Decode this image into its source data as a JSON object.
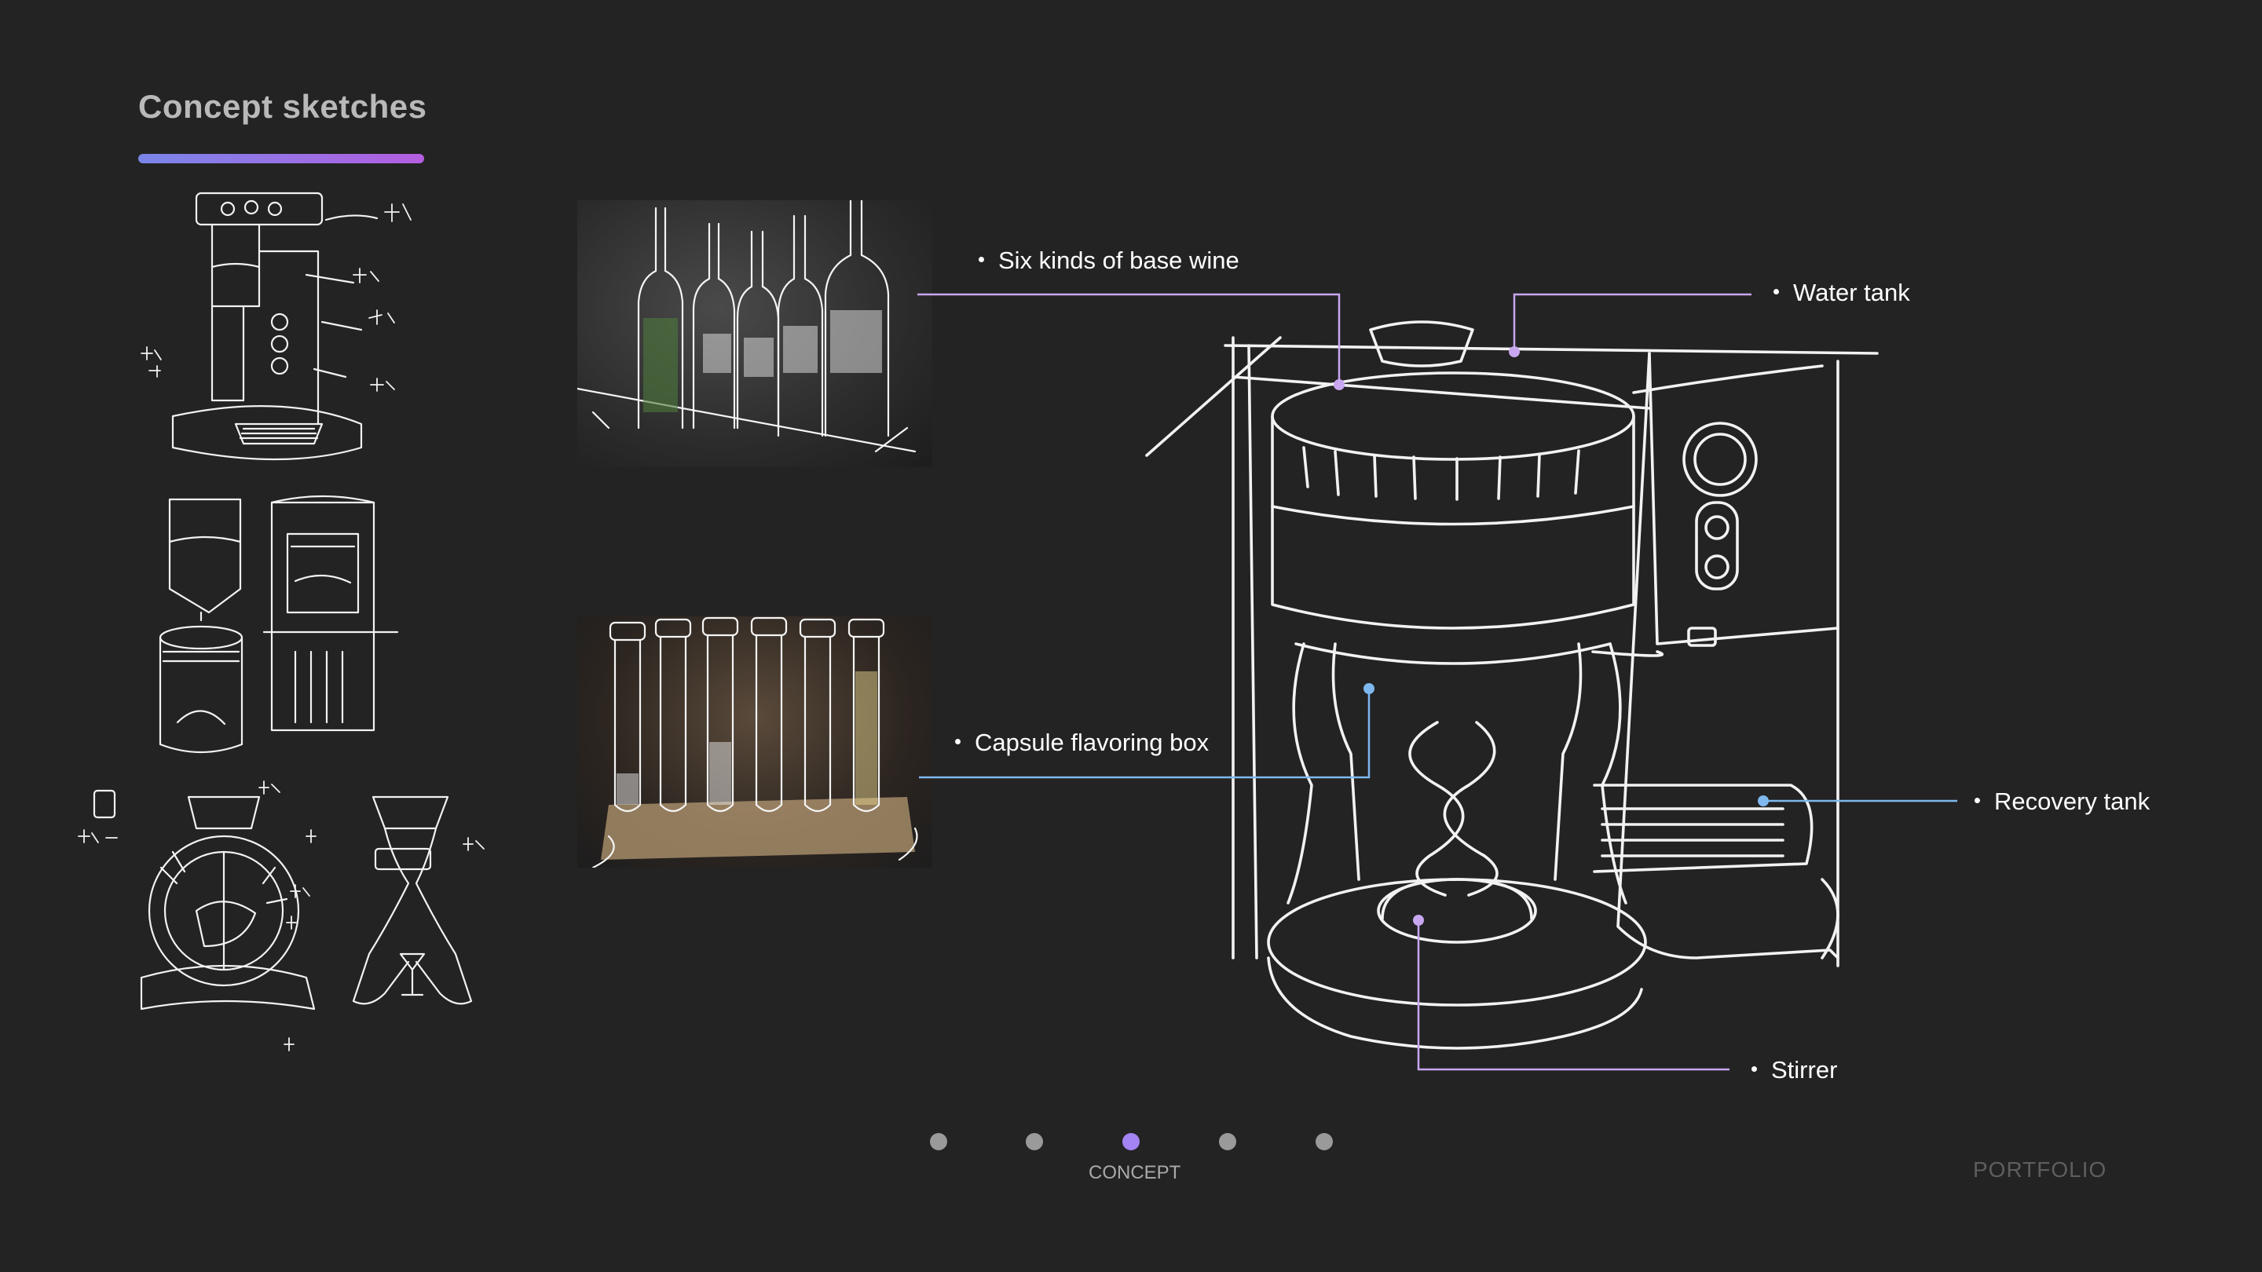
{
  "header": {
    "title": "Concept sketches"
  },
  "callouts": {
    "base_wine": "Six kinds of base wine",
    "water_tank": "Water tank",
    "capsule": "Capsule flavoring box",
    "recovery": "Recovery tank",
    "stirrer": "Stirrer"
  },
  "colors": {
    "accent_purple": "#a483f2",
    "line_purple": "#c8a7f0",
    "line_blue": "#7fb8ee"
  },
  "pager": {
    "active_label": "CONCEPT",
    "total": 5,
    "active_index": 3
  },
  "footer": {
    "brand": "PORTFOLIO"
  }
}
